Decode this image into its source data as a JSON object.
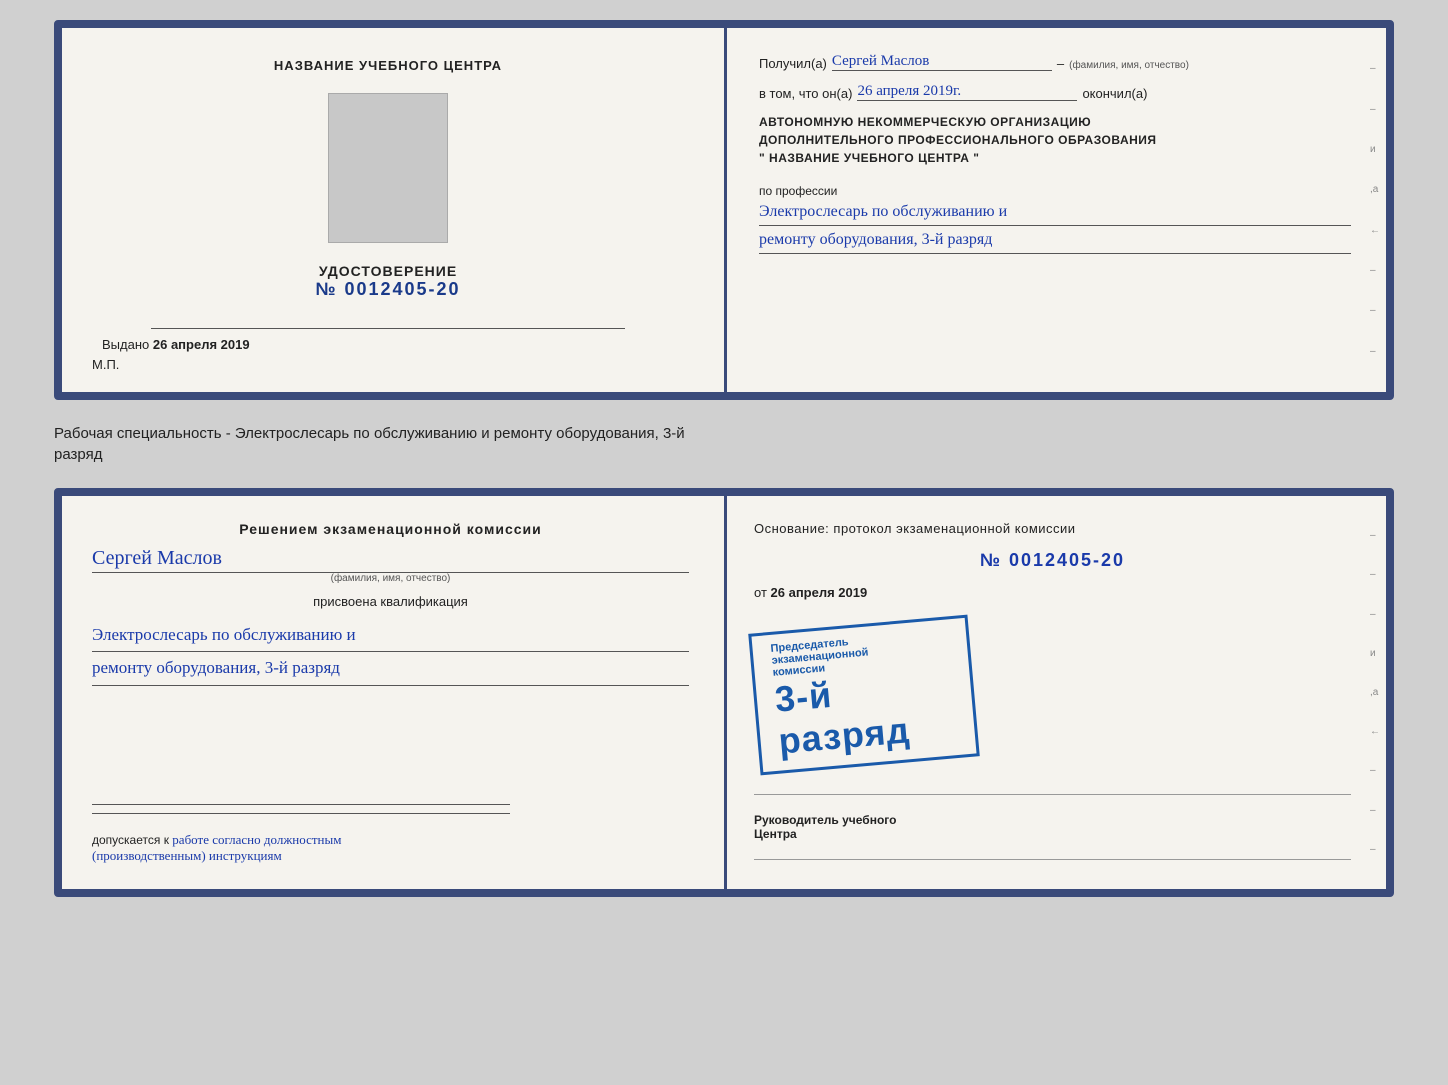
{
  "card1": {
    "left": {
      "center_title": "НАЗВАНИЕ УЧЕБНОГО ЦЕНТРА",
      "udc_title": "УДОСТОВЕРЕНИЕ",
      "udc_number": "№ 0012405-20",
      "vydano_label": "Выдано",
      "vydano_date": "26 апреля 2019",
      "mp_label": "М.П."
    },
    "right": {
      "poluchil_label": "Получил(а)",
      "name_hw": "Сергей Маслов",
      "name_sublabel": "(фамилия, имя, отчество)",
      "dash": "–",
      "vtom_label": "в том, что он(а)",
      "date_hw": "26 апреля 2019г.",
      "okonchil_label": "окончил(а)",
      "block_title_line1": "АВТОНОМНУЮ НЕКОММЕРЧЕСКУЮ ОРГАНИЗАЦИЮ",
      "block_title_line2": "ДОПОЛНИТЕЛЬНОГО ПРОФЕССИОНАЛЬНОГО ОБРАЗОВАНИЯ",
      "block_title_line3": "\"   НАЗВАНИЕ УЧЕБНОГО ЦЕНТРА   \"",
      "po_professii_label": "по профессии",
      "profession_hw_line1": "Электрослесарь по обслуживанию и",
      "profession_hw_line2": "ремонту оборудования, 3-й разряд"
    }
  },
  "between_label": "Рабочая специальность - Электрослесарь по обслуживанию и ремонту оборудования, 3-й\nразряд",
  "card2": {
    "left": {
      "decision_title": "Решением экзаменационной комиссии",
      "name_hw": "Сергей Маслов",
      "name_sublabel": "(фамилия, имя, отчество)",
      "prisvoena_label": "присвоена квалификация",
      "profession_hw_line1": "Электрослесарь по обслуживанию и",
      "profession_hw_line2": "ремонту оборудования, 3-й разряд",
      "dopusk_label": "допускается к",
      "dopusk_hw": "работе согласно должностным\n(производственным) инструкциям"
    },
    "right": {
      "osnov_label": "Основание: протокол экзаменационной комиссии",
      "protocol_number": "№  0012405-20",
      "ot_label": "от",
      "ot_date": "26 апреля 2019",
      "stamp_header": "Председатель экзаменационной\nкомиссии",
      "stamp_big": "3-й разряд",
      "ruk_label": "Руководитель учебного\nЦентра"
    }
  },
  "binding_marks": [
    "-",
    "и",
    ",а",
    "←",
    "-",
    "-",
    "-",
    "-"
  ]
}
